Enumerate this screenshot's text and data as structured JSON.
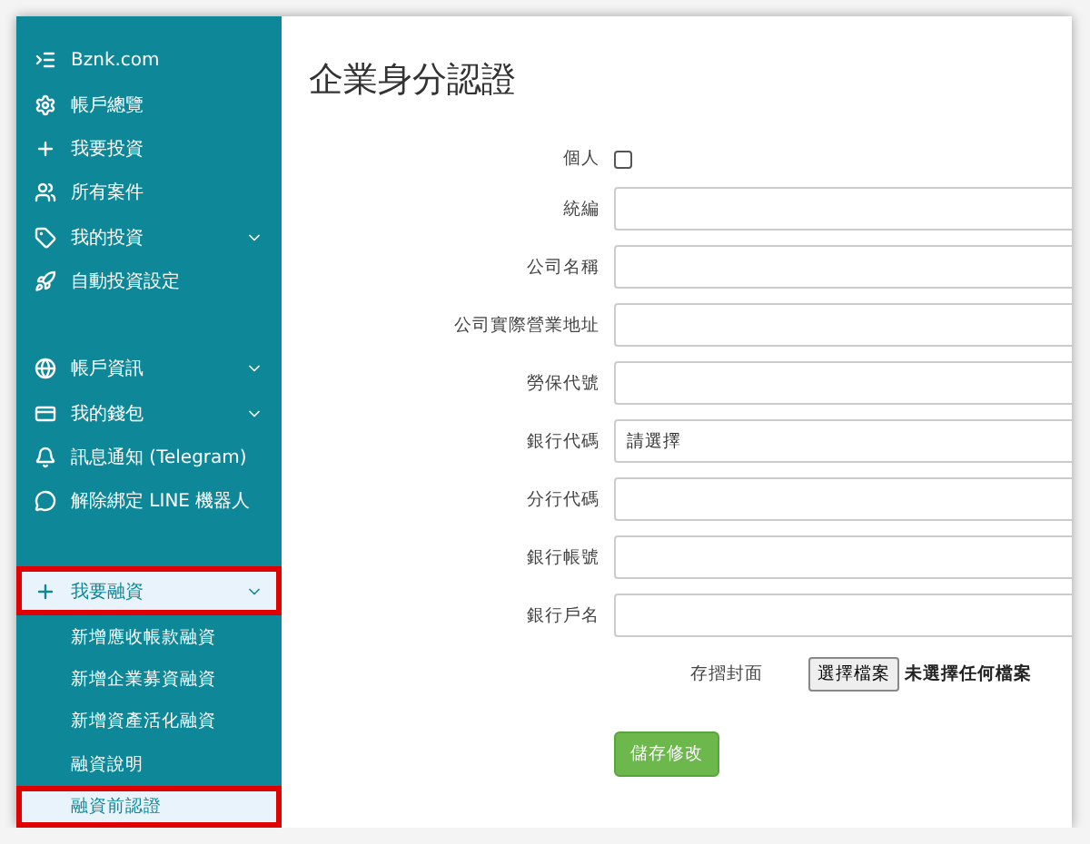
{
  "sidebar": {
    "items": [
      {
        "label": "Bznk.com",
        "expandable": false
      },
      {
        "label": "帳戶總覽",
        "expandable": false
      },
      {
        "label": "我要投資",
        "expandable": false
      },
      {
        "label": "所有案件",
        "expandable": false
      },
      {
        "label": "我的投資",
        "expandable": true
      },
      {
        "label": "自動投資設定",
        "expandable": false
      },
      {
        "label": "帳戶資訊",
        "expandable": true
      },
      {
        "label": "我的錢包",
        "expandable": true
      },
      {
        "label": "訊息通知 (Telegram)",
        "expandable": false
      },
      {
        "label": "解除綁定 LINE 機器人",
        "expandable": false
      }
    ],
    "open_group": {
      "label": "我要融資",
      "expanded": true,
      "highlighted": true,
      "children": [
        {
          "label": "新增應收帳款融資",
          "selected": false,
          "highlighted": false
        },
        {
          "label": "新增企業募資融資",
          "selected": false,
          "highlighted": false
        },
        {
          "label": "新增資產活化融資",
          "selected": false,
          "highlighted": false
        },
        {
          "label": "融資說明",
          "selected": false,
          "highlighted": false
        },
        {
          "label": "融資前認證",
          "selected": true,
          "highlighted": true
        }
      ]
    }
  },
  "form": {
    "title": "企業身分認證",
    "fields": [
      {
        "label": "個人",
        "kind": "checkbox",
        "checked": false
      },
      {
        "label": "統編",
        "kind": "text"
      },
      {
        "label": "公司名稱",
        "kind": "text"
      },
      {
        "label": "公司實際營業地址",
        "kind": "text"
      },
      {
        "label": "勞保代號",
        "kind": "text"
      },
      {
        "label": "銀行代碼",
        "kind": "select",
        "value": "請選擇"
      },
      {
        "label": "分行代碼",
        "kind": "text"
      },
      {
        "label": "銀行帳號",
        "kind": "text"
      },
      {
        "label": "銀行戶名",
        "kind": "text"
      },
      {
        "label": "存摺封面",
        "kind": "file",
        "button": "選擇檔案",
        "status": "未選擇任何檔案"
      }
    ],
    "submit": "儲存修改"
  }
}
